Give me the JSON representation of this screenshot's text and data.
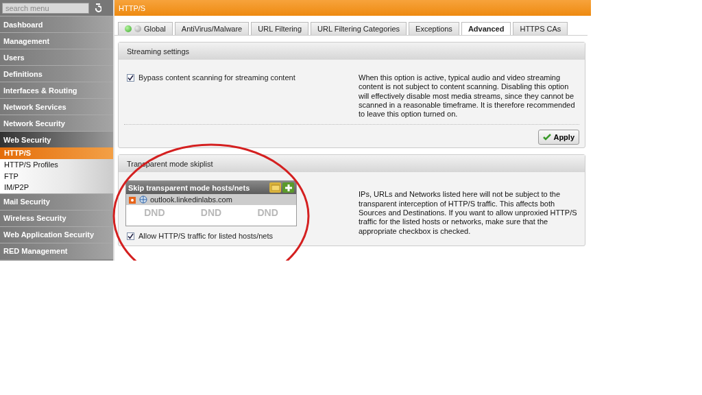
{
  "sidebar": {
    "search": {
      "placeholder": "search menu"
    },
    "items": [
      {
        "label": "Dashboard",
        "selected": false
      },
      {
        "label": "Management",
        "selected": false
      },
      {
        "label": "Users",
        "selected": false
      },
      {
        "label": "Definitions",
        "selected": false
      },
      {
        "label": "Interfaces & Routing",
        "selected": false
      },
      {
        "label": "Network Services",
        "selected": false
      },
      {
        "label": "Network Security",
        "selected": false
      },
      {
        "label": "Web Security",
        "selected": true,
        "children": [
          {
            "label": "HTTP/S",
            "selected": true
          },
          {
            "label": "HTTP/S Profiles",
            "selected": false
          },
          {
            "label": "FTP",
            "selected": false
          },
          {
            "label": "IM/P2P",
            "selected": false
          }
        ]
      },
      {
        "label": "Mail Security",
        "selected": false
      },
      {
        "label": "Wireless Security",
        "selected": false
      },
      {
        "label": "Web Application Security",
        "selected": false
      },
      {
        "label": "RED Management",
        "selected": false
      }
    ]
  },
  "page_title": "HTTP/S",
  "tabs": [
    {
      "label": "Global",
      "selected": false,
      "status_on": true
    },
    {
      "label": "AntiVirus/Malware",
      "selected": false
    },
    {
      "label": "URL Filtering",
      "selected": false
    },
    {
      "label": "URL Filtering Categories",
      "selected": false
    },
    {
      "label": "Exceptions",
      "selected": false
    },
    {
      "label": "Advanced",
      "selected": true
    },
    {
      "label": "HTTPS CAs",
      "selected": false
    }
  ],
  "streaming": {
    "title": "Streaming settings",
    "checkbox": {
      "label": "Bypass content scanning for streaming content",
      "checked": true
    },
    "help": "When this option is active, typical audio and video streaming content is not subject to content scanning. Disabling this option will effectively disable most media streams, since they cannot be scanned in a reasonable timeframe. It is therefore recommended to leave this option turned on.",
    "apply": "Apply"
  },
  "skiplist": {
    "title": "Transparent mode skiplist",
    "list_title": "Skip transparent mode hosts/nets",
    "entries": [
      "outlook.linkedinlabs.com"
    ],
    "drop_hints": [
      "DND",
      "DND",
      "DND"
    ],
    "checkbox": {
      "label": "Allow HTTP/S traffic for listed hosts/nets",
      "checked": true
    },
    "help": "IPs, URLs and Networks listed here will not be subject to the transparent interception of HTTP/S traffic. This affects both Sources and Destinations. If you want to allow unproxied HTTP/S traffic for the listed hosts or networks, make sure that the appropriate checkbox is checked."
  }
}
